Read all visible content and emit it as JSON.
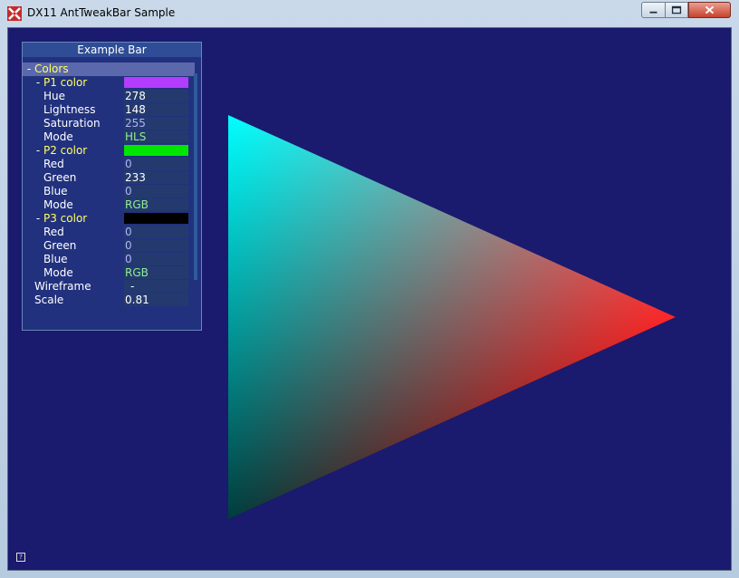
{
  "window": {
    "title": "DX11 AntTweakBar Sample"
  },
  "bar": {
    "title": "Example Bar",
    "rows": [
      {
        "type": "group",
        "label": "Colors",
        "expander": "-"
      },
      {
        "type": "group",
        "label": "P1 color",
        "expander": "-",
        "swatch": "#b33cff"
      },
      {
        "type": "value",
        "label": "Hue",
        "value": "278",
        "readonly": false
      },
      {
        "type": "value",
        "label": "Lightness",
        "value": "148",
        "readonly": false
      },
      {
        "type": "value",
        "label": "Saturation",
        "value": "255",
        "readonly": true
      },
      {
        "type": "enum",
        "label": "Mode",
        "value": "HLS"
      },
      {
        "type": "group",
        "label": "P2 color",
        "expander": "-",
        "swatch": "#00e600"
      },
      {
        "type": "value",
        "label": "Red",
        "value": "0",
        "readonly": true
      },
      {
        "type": "value",
        "label": "Green",
        "value": "233",
        "readonly": false
      },
      {
        "type": "value",
        "label": "Blue",
        "value": "0",
        "readonly": true
      },
      {
        "type": "enum",
        "label": "Mode",
        "value": "RGB"
      },
      {
        "type": "group",
        "label": "P3 color",
        "expander": "-",
        "swatch": "#000000"
      },
      {
        "type": "value",
        "label": "Red",
        "value": "0",
        "readonly": true
      },
      {
        "type": "value",
        "label": "Green",
        "value": "0",
        "readonly": true
      },
      {
        "type": "value",
        "label": "Blue",
        "value": "0",
        "readonly": true
      },
      {
        "type": "enum",
        "label": "Mode",
        "value": "RGB"
      },
      {
        "type": "value",
        "label": "Wireframe",
        "value": "-",
        "readonly": false
      },
      {
        "type": "value",
        "label": "Scale",
        "value": "0.81",
        "readonly": false
      }
    ]
  },
  "help_icon": "?",
  "triangle_colors": {
    "top": "#00ffff",
    "right": "#ff0000",
    "bottom": "#000000"
  },
  "icons": [
    "app-icon",
    "minimize-icon",
    "maximize-icon",
    "close-icon",
    "help-icon"
  ]
}
